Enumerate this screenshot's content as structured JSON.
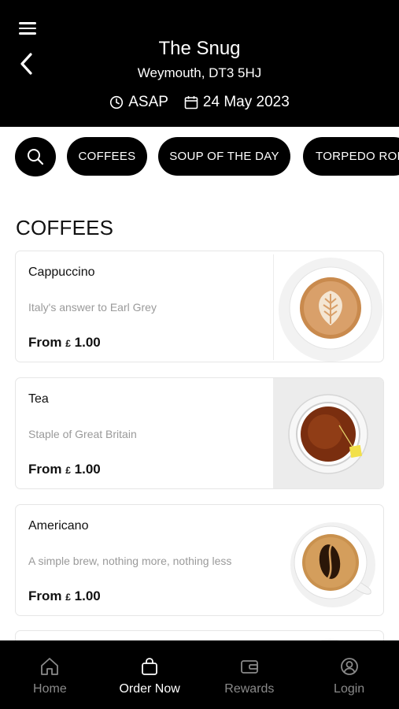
{
  "header": {
    "store_name": "The Snug",
    "location": "Weymouth, DT3 5HJ",
    "time": "ASAP",
    "date": "24 May 2023",
    "icons": {
      "menu": "hamburger-menu-icon",
      "back": "chevron-left-icon",
      "clock": "clock-icon",
      "calendar": "calendar-icon"
    }
  },
  "categories": [
    {
      "label": "COFFEES"
    },
    {
      "label": "SOUP OF THE DAY"
    },
    {
      "label": "TORPEDO ROLLS"
    }
  ],
  "section": {
    "title": "COFFEES"
  },
  "products": [
    {
      "name": "Cappuccino",
      "description": "Italy's answer to Earl Grey",
      "price_prefix": "From",
      "currency": "£",
      "price": "1.00",
      "image": "cappuccino-image"
    },
    {
      "name": "Tea",
      "description": "Staple of Great Britain",
      "price_prefix": "From",
      "currency": "£",
      "price": "1.00",
      "image": "tea-image"
    },
    {
      "name": "Americano",
      "description": "A simple brew, nothing more, nothing less",
      "price_prefix": "From",
      "currency": "£",
      "price": "1.00",
      "image": "americano-image"
    }
  ],
  "nav": [
    {
      "label": "Home",
      "icon": "home-icon",
      "active": false
    },
    {
      "label": "Order Now",
      "icon": "bag-icon",
      "active": true
    },
    {
      "label": "Rewards",
      "icon": "wallet-icon",
      "active": false
    },
    {
      "label": "Login",
      "icon": "user-icon",
      "active": false
    }
  ],
  "colors": {
    "primary": "#000000",
    "nav_inactive": "#8a8a8a",
    "description": "#9a9a9a"
  }
}
